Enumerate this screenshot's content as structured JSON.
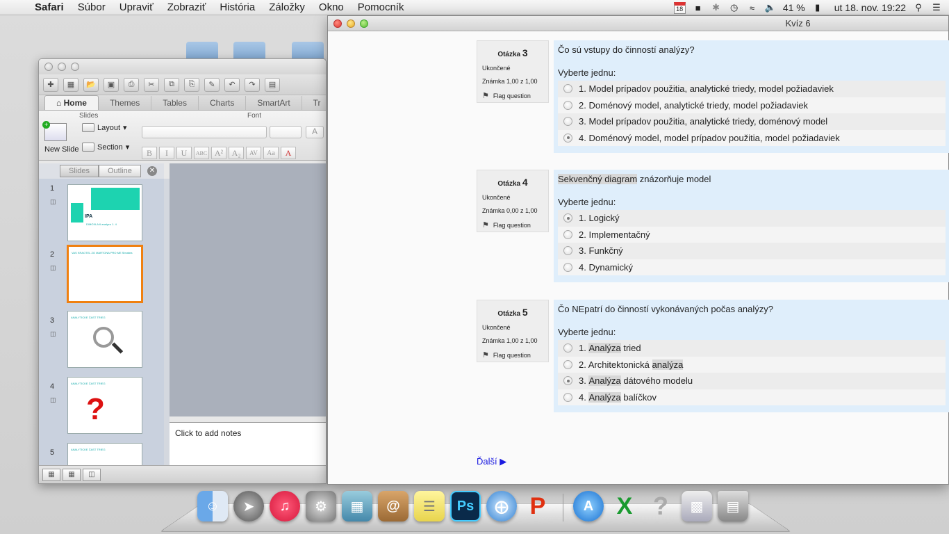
{
  "menubar": {
    "app": "Safari",
    "items": [
      "Súbor",
      "Upraviť",
      "Zobraziť",
      "História",
      "Záložky",
      "Okno",
      "Pomocník"
    ],
    "calendar_day": "18",
    "battery": "41 %",
    "datetime": "ut 18. nov.  19:22"
  },
  "ppt": {
    "toolbar_icons": [
      "new-icon",
      "gallery-icon",
      "open-icon",
      "save-icon",
      "print-icon",
      "cut-icon",
      "copy-icon",
      "paste-icon",
      "format-painter-icon",
      "undo-icon",
      "redo-icon"
    ],
    "tabs": [
      "Home",
      "Themes",
      "Tables",
      "Charts",
      "SmartArt",
      "Tr"
    ],
    "groups": {
      "slides": "Slides",
      "font": "Font"
    },
    "new_slide": "New Slide",
    "layout": "Layout",
    "section": "Section",
    "format_buttons": [
      "B",
      "I",
      "U",
      "ABC",
      "A²",
      "A₂",
      "AV",
      "Aa",
      "A"
    ],
    "pane_tabs": [
      "Slides",
      "Outline"
    ],
    "slides": [
      {
        "num": "1",
        "title": "IPA",
        "subtitle": "DIMOXLA 6 analyzu 1. 4"
      },
      {
        "num": "2",
        "title": "VAS KRAOTEL ZO MARTONA PRO ME Sbvatea"
      },
      {
        "num": "3",
        "title": "ANALYTICKE ČAST TRIEG"
      },
      {
        "num": "4",
        "title": "ANALYTICKE ČAST TRIEG"
      },
      {
        "num": "5",
        "title": "ANALYTICKE ČAST TRIEG"
      }
    ],
    "notes_placeholder": "Click to add notes"
  },
  "safari": {
    "title": "Kvíz 6",
    "questions": [
      {
        "label": "Otázka",
        "number": "3",
        "status": "Ukončené",
        "grade": "Známka 1,00 z 1,00",
        "flag": "Flag question",
        "text": "Čo sú vstupy do činností analýzy?",
        "prompt": "Vyberte jednu:",
        "answers": [
          {
            "label": "1. Model prípadov použitia, analytické triedy, model požiadaviek",
            "checked": false
          },
          {
            "label": "2. Doménový model, analytické triedy, model požiadaviek",
            "checked": false
          },
          {
            "label": "3. Model prípadov použitia, analytické triedy, doménový model",
            "checked": false
          },
          {
            "label": "4. Doménový model, model prípadov použitia, model požiadaviek",
            "checked": true
          }
        ]
      },
      {
        "label": "Otázka",
        "number": "4",
        "status": "Ukončené",
        "grade": "Známka 0,00 z 1,00",
        "flag": "Flag question",
        "text_highlight": "Sekvenčný diagram",
        "text_rest": " znázorňuje model",
        "prompt": "Vyberte jednu:",
        "answers": [
          {
            "label": "1. Logický",
            "checked": true
          },
          {
            "label": "2. Implementačný",
            "checked": false
          },
          {
            "label": "3. Funkčný",
            "checked": false
          },
          {
            "label": "4. Dynamický",
            "checked": false
          }
        ]
      },
      {
        "label": "Otázka",
        "number": "5",
        "status": "Ukončené",
        "grade": "Známka 1,00 z 1,00",
        "flag": "Flag question",
        "text": "Čo NEpatrí do činností vykonávaných počas analýzy?",
        "prompt": "Vyberte jednu:",
        "answers": [
          {
            "prefix": "1. ",
            "hl": "Analýza",
            "rest": " tried",
            "checked": false
          },
          {
            "prefix": "2. Architektonická ",
            "hl": "analýza",
            "rest": "",
            "checked": false
          },
          {
            "prefix": "3. ",
            "hl": "Analýza",
            "rest": " dátového modelu",
            "checked": true
          },
          {
            "prefix": "4. ",
            "hl": "Analýza",
            "rest": " balíčkov",
            "checked": false
          }
        ]
      }
    ],
    "next": "Ďalší ▶"
  },
  "dock": [
    "finder-icon",
    "launchpad-icon",
    "itunes-icon",
    "system-preferences-icon",
    "preview-icon",
    "contacts-icon",
    "stickies-icon",
    "photoshop-icon",
    "safari-icon",
    "powerpoint-icon",
    "app-store-icon",
    "excel-icon",
    "help-icon",
    "network-icon",
    "trash-icon"
  ],
  "dock_labels": {
    "photoshop": "Ps",
    "help": "?"
  },
  "colors": {
    "question_bg": "#dfeefb",
    "info_bg": "#eeeeee",
    "link": "#1a1ae0",
    "slide_selection": "#f08010"
  }
}
